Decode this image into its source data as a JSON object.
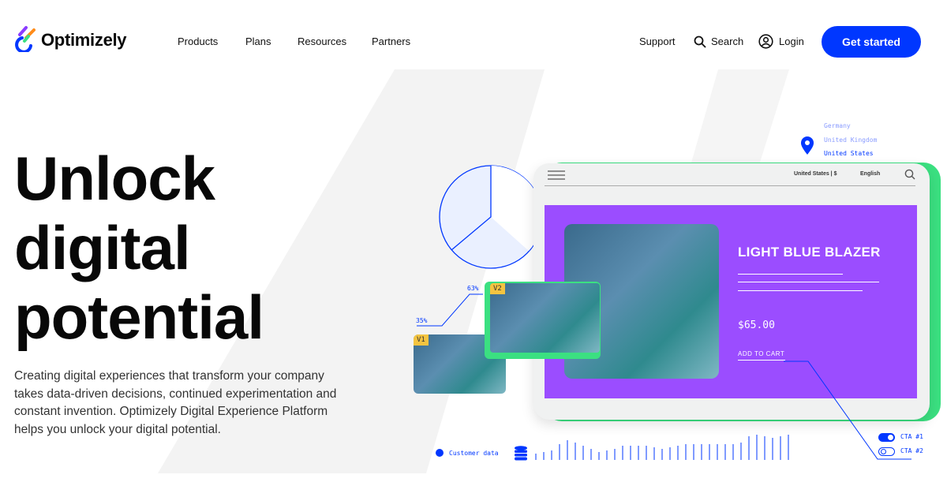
{
  "nav": {
    "brand": "Optimizely",
    "items": [
      "Products",
      "Plans",
      "Resources",
      "Partners"
    ],
    "support": "Support",
    "search": "Search",
    "login": "Login",
    "get_started": "Get started"
  },
  "hero": {
    "heading_lines": [
      "Unlock",
      "digital",
      "potential"
    ],
    "description": "Creating digital experiences that transform your company takes data-driven decisions, continued experimentation and constant invention. Optimizely Digital Experience Platform helps you unlock your digital potential."
  },
  "illustration": {
    "locations": [
      "Germany",
      "United Kingdom",
      "United States"
    ],
    "tablet": {
      "region": "United States | $",
      "language": "English"
    },
    "product": {
      "name": "LIGHT BLUE BLAZER",
      "price": "$65.00",
      "add_to_cart": "ADD TO CART"
    },
    "variants": {
      "v1": "V1",
      "v2": "V2",
      "v1_pct": "35%",
      "v2_pct": "63%"
    },
    "customer_data": "Customer data",
    "ctas": [
      {
        "label": "CTA #1",
        "on": true
      },
      {
        "label": "CTA #2",
        "on": false
      }
    ],
    "colors": {
      "blue": "#0037ff",
      "purple": "#9b4dff",
      "green": "#3be081"
    }
  }
}
